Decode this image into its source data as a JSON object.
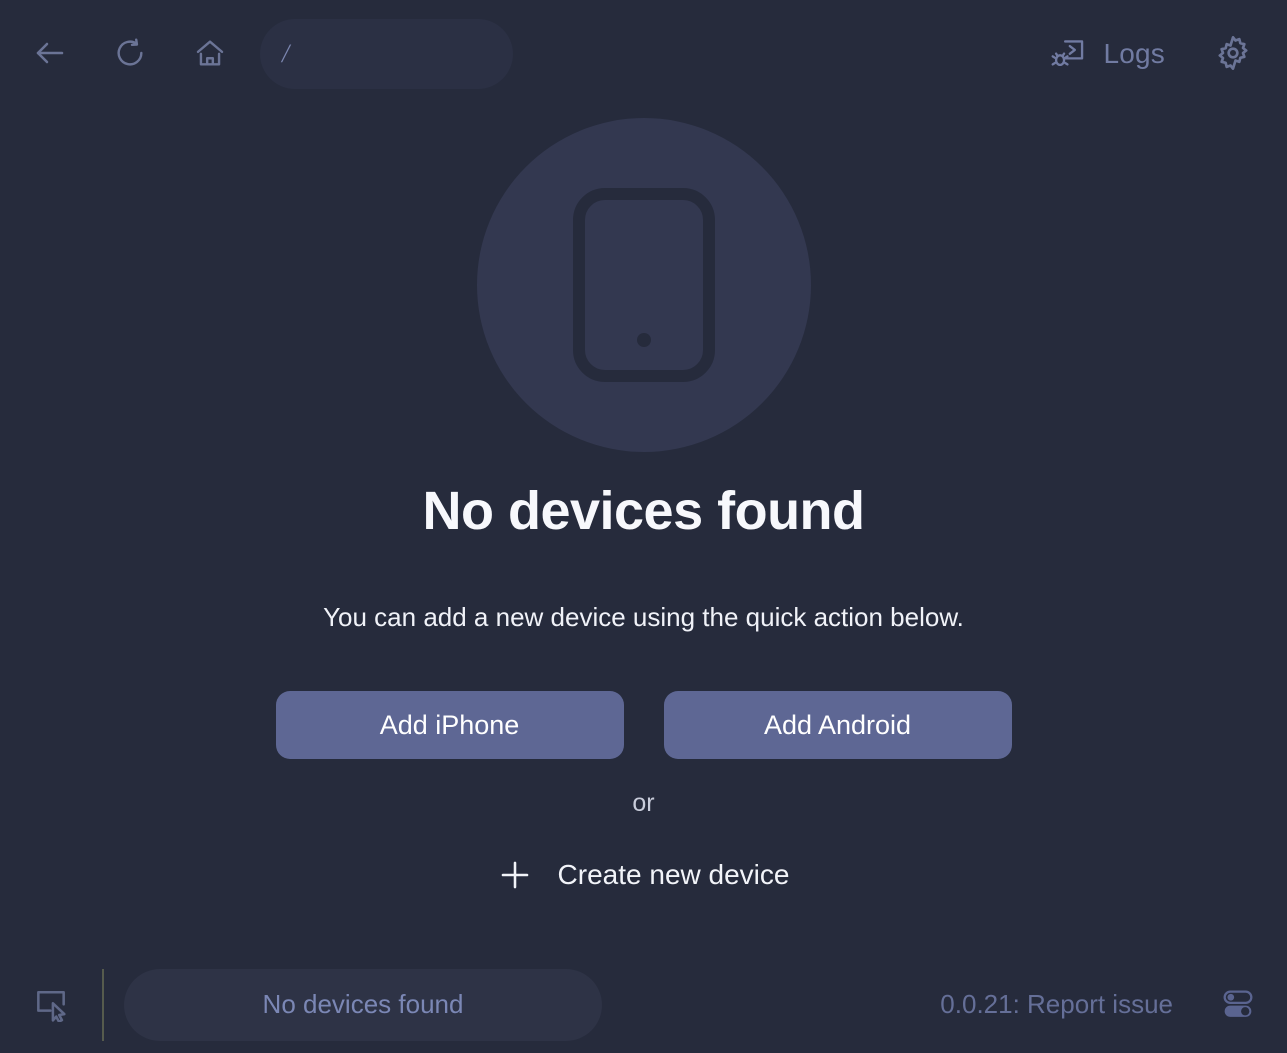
{
  "window": {
    "background_color": "#262b3c"
  },
  "topbar": {
    "back_icon": "arrow-left-icon",
    "reload_icon": "reload-icon",
    "home_icon": "home-icon",
    "address": {
      "value": "/",
      "placeholder": "/"
    },
    "logs": {
      "icon": "terminal-bug-icon",
      "label": "Logs"
    },
    "settings": {
      "icon": "gear-icon"
    }
  },
  "main": {
    "illustration_icon": "smartphone-icon",
    "illustration_circle_color": "#333850",
    "title": "No devices found",
    "subtitle": "You can add a new device using the quick action below.",
    "quick_actions": [
      {
        "label": "Add iPhone",
        "color": "#5e6794"
      },
      {
        "label": "Add Android",
        "color": "#5e6794"
      }
    ],
    "or_label": "or",
    "create_device": {
      "icon": "plus-icon",
      "label": "Create new device"
    }
  },
  "bottombar": {
    "inspect_icon": "inspect-element-icon",
    "status": "No devices found",
    "report": "0.0.21: Report issue",
    "toggles_icon": "toggles-icon",
    "accent_color": "#7b87b5"
  }
}
